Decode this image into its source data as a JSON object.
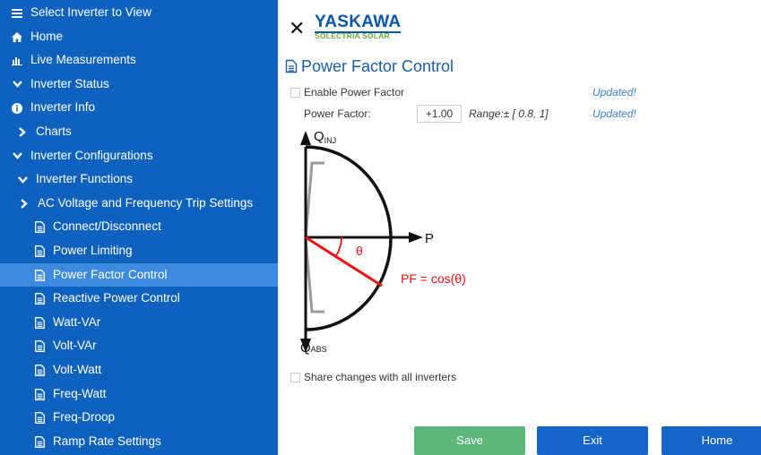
{
  "sidebar": {
    "items": [
      {
        "label": "Select Inverter to View",
        "icon": "list-icon"
      },
      {
        "label": "Home",
        "icon": "home-icon"
      },
      {
        "label": "Live Measurements",
        "icon": "bar-chart-icon"
      },
      {
        "label": "Inverter Status",
        "icon": "chevron-down-icon"
      },
      {
        "label": "Inverter Info",
        "icon": "info-icon"
      },
      {
        "label": "Charts",
        "icon": "chevron-right-icon"
      },
      {
        "label": "Inverter Configurations",
        "icon": "chevron-down-icon"
      },
      {
        "label": "Inverter Functions",
        "icon": "chevron-down-icon"
      },
      {
        "label": "AC Voltage and Frequency Trip Settings",
        "icon": "chevron-right-icon"
      },
      {
        "label": "Connect/Disconnect",
        "icon": "document-icon"
      },
      {
        "label": "Power Limiting",
        "icon": "document-icon"
      },
      {
        "label": "Power Factor Control",
        "icon": "document-icon",
        "active": true
      },
      {
        "label": "Reactive Power Control",
        "icon": "document-icon"
      },
      {
        "label": "Watt-VAr",
        "icon": "document-icon"
      },
      {
        "label": "Volt-VAr",
        "icon": "document-icon"
      },
      {
        "label": "Volt-Watt",
        "icon": "document-icon"
      },
      {
        "label": "Freq-Watt",
        "icon": "document-icon"
      },
      {
        "label": "Freq-Droop",
        "icon": "document-icon"
      },
      {
        "label": "Ramp Rate Settings",
        "icon": "document-icon"
      }
    ]
  },
  "logo": {
    "name": "YASKAWA",
    "sub": "SOLECTRIA SOLAR"
  },
  "main": {
    "title": "Power Factor Control",
    "enable_label": "Enable Power Factor",
    "enable_status": "Updated!",
    "pf_label": "Power Factor:",
    "pf_value": "+1.00",
    "pf_range": "Range:± [ 0.8, 1]",
    "pf_status": "Updated!",
    "share_label": "Share changes with all inverters"
  },
  "diagram": {
    "q_inj": "Q",
    "q_inj_sub": "INJ",
    "q_abs": "Q",
    "q_abs_sub": "ABS",
    "p_label": "P",
    "theta": "θ",
    "pf_formula": "PF = cos(θ)"
  },
  "buttons": {
    "save": "Save",
    "exit": "Exit",
    "home": "Home"
  },
  "colors": {
    "sidebar": "#0e62bd",
    "active": "#3d8be0",
    "save": "#5cb87a",
    "action": "#1565c9",
    "title": "#1a5ea8"
  }
}
